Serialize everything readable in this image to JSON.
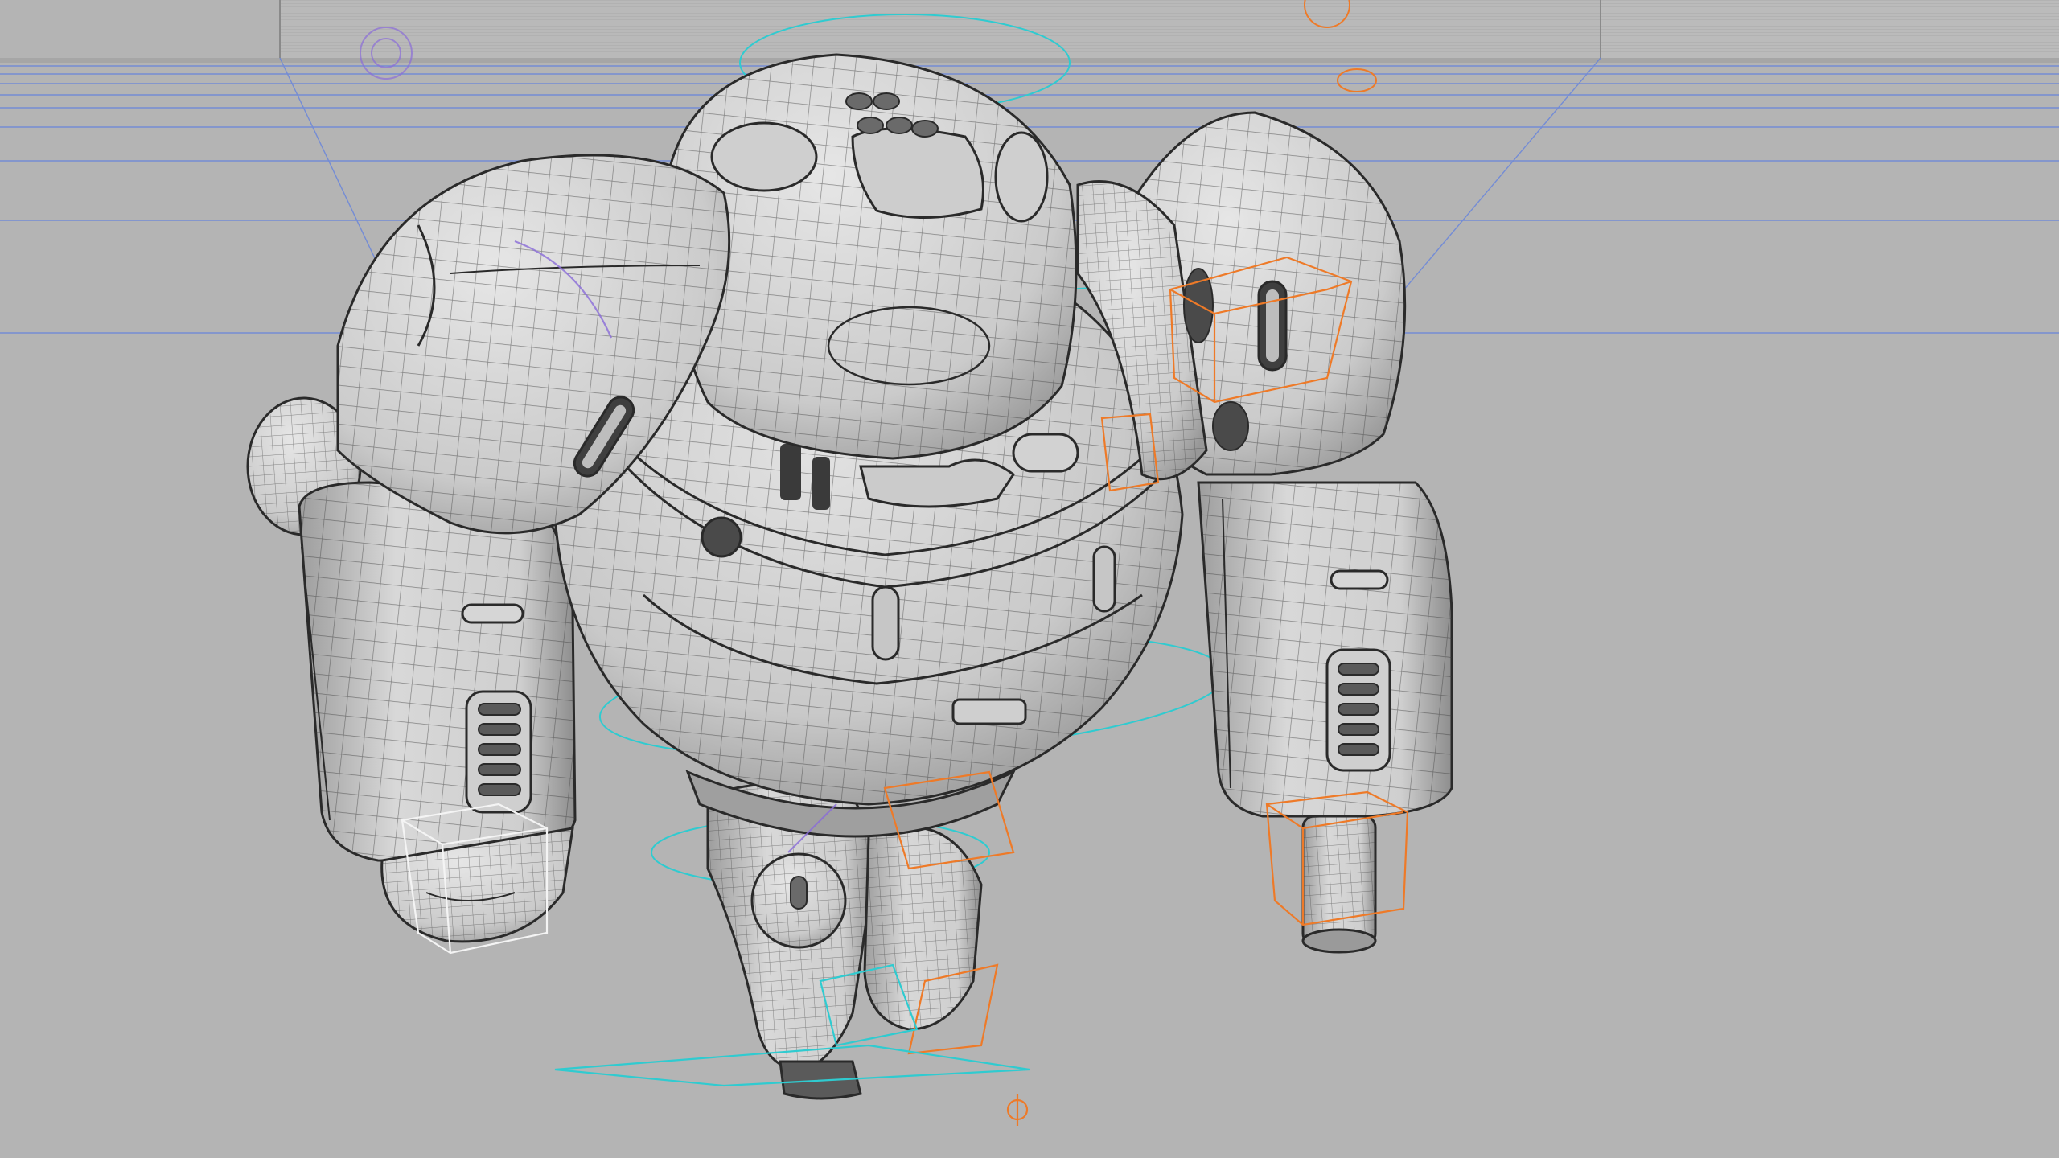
{
  "viewport": {
    "background_color": "#b4b4b4",
    "backdrop_color": "#b0b0b0",
    "wire_color": "#3a3a3a",
    "surface_color": "#d4d4d4",
    "shade_color": "#9c9c9c",
    "grid_color": "#5f7fe0",
    "rig_color_cyan": "#2fcbd0",
    "rig_color_orange": "#ee7a28",
    "rig_color_white": "#f4f4f4",
    "rig_color_purple": "#8a6cd8"
  },
  "scene": {
    "subject": "robot-character",
    "display_mode": "wireframe-on-shaded",
    "icons": [
      "transform-locator-icon",
      "ik-control-icon"
    ]
  }
}
